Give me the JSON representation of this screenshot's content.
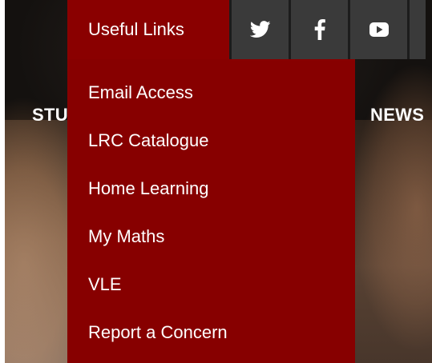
{
  "nav": {
    "left_label": "STU",
    "right_label": "NEWS"
  },
  "topbar": {
    "useful_links_label": "Useful Links",
    "social_icons": [
      "twitter-icon",
      "facebook-icon",
      "youtube-icon"
    ]
  },
  "dropdown": {
    "items": [
      {
        "label": "Email Access"
      },
      {
        "label": "LRC Catalogue"
      },
      {
        "label": "Home Learning"
      },
      {
        "label": "My Maths"
      },
      {
        "label": "VLE"
      },
      {
        "label": "Report a Concern"
      }
    ]
  },
  "colors": {
    "brand_red": "#8a0000",
    "social_bg": "#3a3a3a"
  }
}
